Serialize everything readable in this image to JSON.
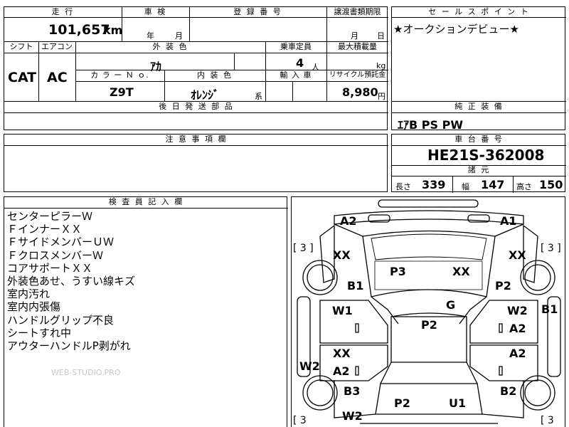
{
  "sheet": {
    "mileage_header": "走 行",
    "mileage_value": "101,657",
    "mileage_unit": "km",
    "inspection_header": "車 検",
    "inspection_year": "年",
    "inspection_month": "月",
    "registration_header": "登 録 番 号",
    "transfer_header": "譲渡書類期限",
    "transfer_month": "月",
    "transfer_day": "日",
    "shift_header": "シフト",
    "shift_value": "CAT",
    "ac_header": "エアコン",
    "ac_value": "AC",
    "exterior_color_header": "外 装 色",
    "exterior_color_value": "ｱｶ",
    "capacity_header": "乗車定員",
    "capacity_value": "4",
    "capacity_unit": "人",
    "max_load_header": "最大積載量",
    "max_load_unit": "kg",
    "color_no_header": "カ ラ ー Ｎ ｏ.",
    "color_no_value": "Z9T",
    "interior_color_header": "内 装 色",
    "interior_color_value": "ｵﾚﾝｼﾞ",
    "interior_color_suffix": "系",
    "import_header": "輸 入 車",
    "recycle_header": "リサイクル預託金",
    "recycle_value": "8,980",
    "recycle_unit": "円",
    "later_parts_header": "後 日 発 送 部 品",
    "notes_header": "注 意 事 項 欄"
  },
  "sales_point": {
    "header": "セ ー ル ス ポ イ ン ト",
    "text": "★オークションデビュー★"
  },
  "equipment": {
    "header": "純 正 装 備",
    "text": "ｴｱB PS PW"
  },
  "chassis": {
    "header": "車 台 番 号",
    "value": "HE21S-362008",
    "spec_header": "諸 元",
    "length_label": "長さ",
    "length_value": "339",
    "width_label": "幅",
    "width_value": "147",
    "height_label": "高さ",
    "height_value": "150"
  },
  "inspector": {
    "header": "検 査 員 記 入 欄",
    "lines": [
      "センターピラーＷ",
      "ＦインナーＸＸ",
      "ＦサイドメンバーＵＷ",
      "ＦクロスメンバーＷ",
      "コアサポートＸＸ",
      "外装色あせ、うすい線キズ",
      "室内汚れ",
      "室内内張傷",
      "ハンドルグリップ不良",
      "シートすれ中",
      "アウターハンドルP剥がれ"
    ],
    "watermark": "WEB-STUDIO.PRO"
  },
  "diagram": {
    "tl_bracket": "[ 3 ]",
    "tr_bracket": "[ 3 ]",
    "bl_bracket": "[ 3",
    "br_bracket": "[ 3",
    "labels": {
      "a2_top": "A2",
      "a1_top": "A1",
      "xx_fl": "XX",
      "xx_fr": "XX",
      "p3": "P3",
      "xx_hood": "XX",
      "b1_left": "B1",
      "p2_right": "P2",
      "w1": "W1",
      "g": "G",
      "w2_rf": "W2",
      "b1_right": "B1",
      "p2_roof": "P2",
      "a2_rf": "A2",
      "xx_rl": "XX",
      "a2_rr": "A2",
      "w2_left": "W2",
      "a2_rl": "A2",
      "b3": "B3",
      "b2": "B2",
      "p2_trunk": "P2",
      "u1": "U1",
      "w2_rear": "W2"
    }
  }
}
